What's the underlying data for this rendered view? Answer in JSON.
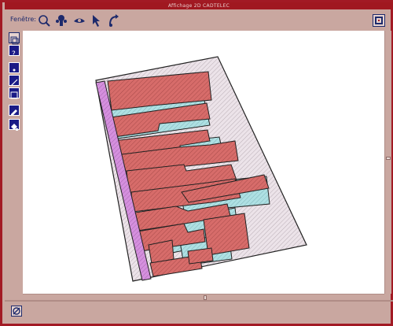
{
  "window": {
    "title": "Affichage 2D CADTELEC"
  },
  "toolbar": {
    "label": "Fenêtre:",
    "icons": [
      "zoom-icon",
      "pan-icon",
      "view-icon",
      "pointer-icon",
      "rotate-icon"
    ]
  },
  "left_toolbar": {
    "icons": [
      "layer-icon",
      "query-icon",
      "point-icon",
      "line-icon",
      "rectangle-icon",
      "edit-icon",
      "fill-icon"
    ]
  },
  "colors": {
    "window_frame": "#a21a24",
    "window_bg": "#c9a7a0",
    "building": "#d76c6a",
    "court": "#a9dfe2",
    "ground": "#e6dde3",
    "road": "#d090dc"
  }
}
